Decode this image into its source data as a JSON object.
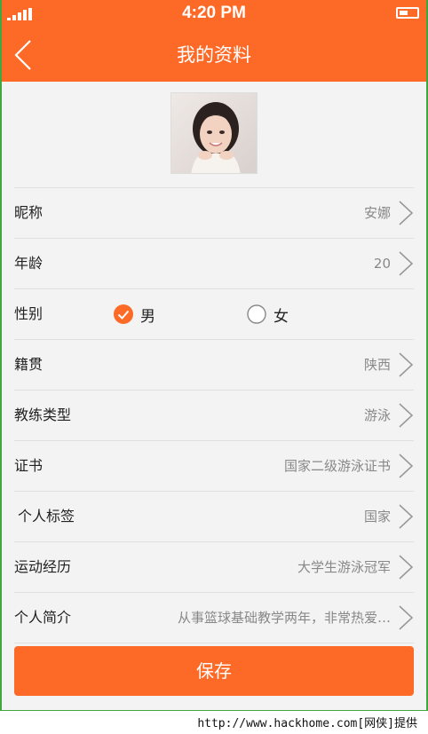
{
  "status_bar": {
    "time": "4:20 PM"
  },
  "nav": {
    "title": "我的资料"
  },
  "profile": {
    "rows": [
      {
        "label": "昵称",
        "value": "安娜"
      },
      {
        "label": "年龄",
        "value": "20"
      },
      {
        "label": "性别",
        "male": "男",
        "female": "女",
        "selected": "男"
      },
      {
        "label": "籍贯",
        "value": "陕西"
      },
      {
        "label": "教练类型",
        "value": "游泳"
      },
      {
        "label": "证书",
        "value": "国家二级游泳证书"
      },
      {
        "label": "个人标签",
        "value": "国家"
      },
      {
        "label": "运动经历",
        "value": "大学生游泳冠军"
      },
      {
        "label": "个人简介",
        "value": "从事篮球基础教学两年，非常热爱…"
      }
    ]
  },
  "save_label": "保存",
  "watermark": "http://www.hackhome.com[网侠]提供",
  "colors": {
    "accent": "#fd6a27",
    "frame": "#3ea83f"
  },
  "icons": {
    "back": "chevron-left-icon",
    "row_arrow": "chevron-right-icon",
    "radio_checked": "check-circle-icon",
    "radio_unchecked": "circle-outline-icon"
  }
}
